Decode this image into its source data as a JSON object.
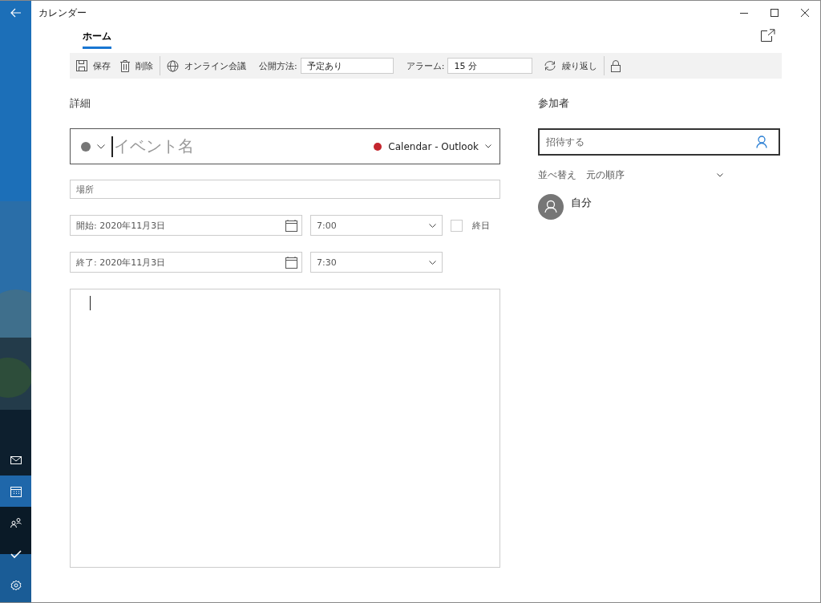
{
  "window": {
    "title": "カレンダー"
  },
  "nav": [
    {
      "kind": "mail",
      "selected": false
    },
    {
      "kind": "calendar",
      "selected": true
    },
    {
      "kind": "people",
      "selected": false
    },
    {
      "kind": "todo",
      "selected": false
    },
    {
      "kind": "settings",
      "selected": false
    }
  ],
  "tabs": [
    {
      "label": "ホーム",
      "selected": true
    }
  ],
  "toolbar": {
    "save": "保存",
    "delete": "削除",
    "online_meeting": "オンライン会議",
    "show_as_label": "公開方法:",
    "show_as": "予定あり",
    "alarm_label": "アラーム:",
    "alarm": "15 分",
    "repeat": "繰り返し"
  },
  "details": {
    "heading": "詳細",
    "event_name_placeholder": "イベント名",
    "calendar": "Calendar - Outlook",
    "location_placeholder": "場所",
    "start_label": "開始:",
    "start_date": "2020年11月3日",
    "start_time": "7:00",
    "all_day_label": "終日",
    "all_day_checked": false,
    "end_label": "終了:",
    "end_date": "2020年11月3日",
    "end_time": "7:30"
  },
  "attendees": {
    "heading": "参加者",
    "invite_placeholder": "招待する",
    "sort_label": "並べ替え",
    "sort_value": "元の順序",
    "people": [
      {
        "name": "自分"
      }
    ]
  }
}
